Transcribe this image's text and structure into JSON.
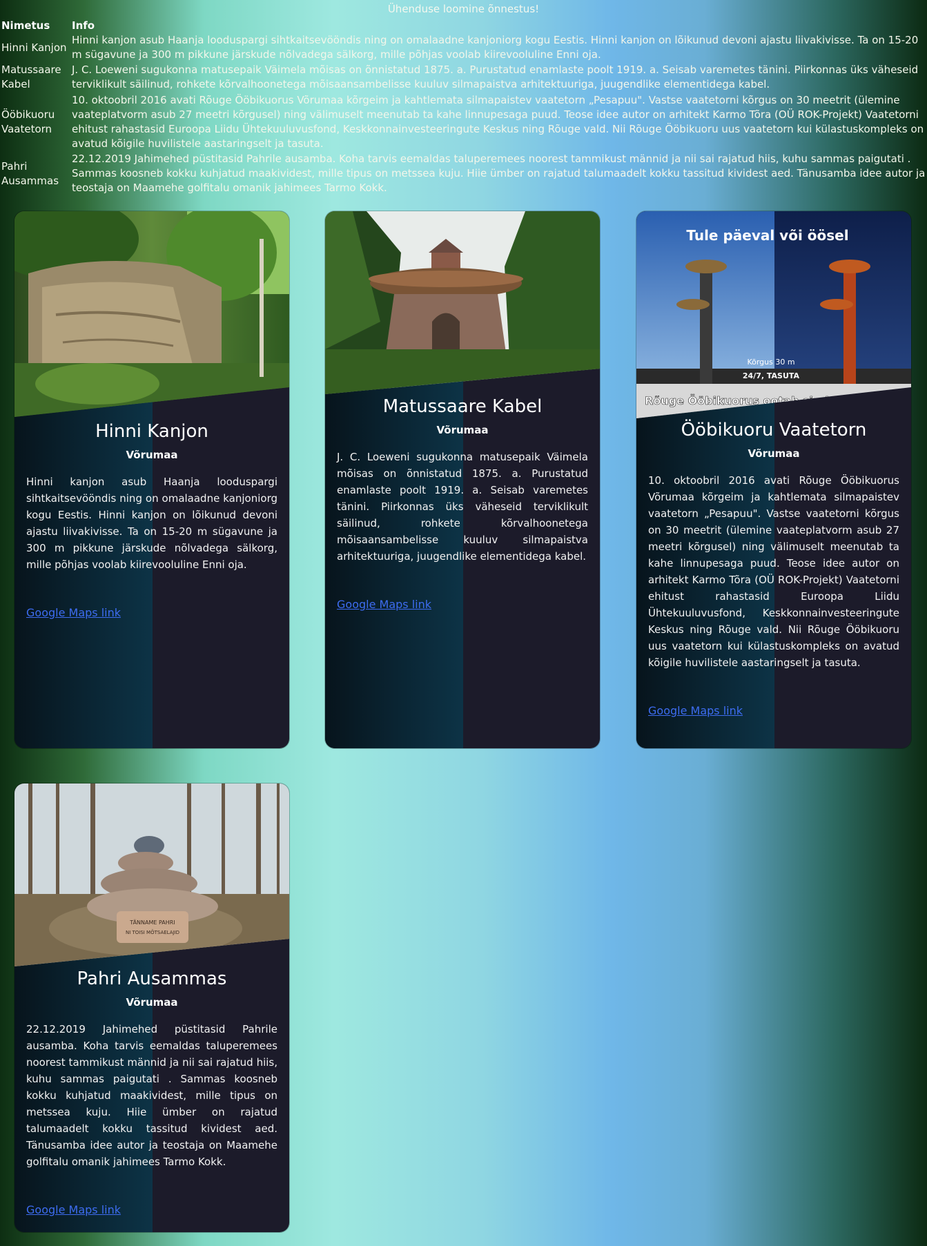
{
  "status_message": "Ühenduse loomine õnnestus!",
  "table": {
    "headers": [
      "Nimetus",
      "Info"
    ],
    "rows": [
      {
        "name_line1": "Hinni Kanjon",
        "name_line2": "",
        "info": "Hinni kanjon asub Haanja looduspargi sihtkaitsevööndis ning on omalaadne kanjoniorg kogu Eestis. Hinni kanjon on lõikunud devoni ajastu liivakivisse. Ta on 15-20 m sügavune ja 300 m pikkune järskude nõlvadega sälkorg, mille põhjas voolab kiirevooluline Enni oja."
      },
      {
        "name_line1": "Matussaare",
        "name_line2": "Kabel",
        "info": "J. C. Loeweni sugukonna matusepaik Väimela mõisas on õnnistatud 1875. a. Purustatud enamlaste poolt 1919. a. Seisab varemetes tänini. Piirkonnas üks väheseid terviklikult säilinud, rohkete kõrvalhoonetega mõisaansambelisse kuuluv silmapaistva arhitektuuriga, juugendlike elementidega kabel."
      },
      {
        "name_line1": "Ööbikuoru",
        "name_line2": "Vaatetorn",
        "info": "10. oktoobril 2016 avati Rõuge Ööbikuorus Võrumaa kõrgeim ja kahtlemata silmapaistev vaatetorn „Pesapuu\". Vastse vaatetorni kõrgus on 30 meetrit (ülemine vaateplatvorm asub 27 meetri kõrgusel) ning välimuselt meenutab ta kahe linnupesaga puud. Teose idee autor on arhitekt Karmo Tõra (OÜ ROK-Projekt) Vaatetorni ehitust rahastasid Euroopa Liidu Ühtekuuluvusfond, Keskkonnainvesteeringute Keskus ning Rõuge vald. Nii Rõuge Ööbikuoru uus vaatetorn kui külastuskompleks on avatud kõigile huvilistele aastaringselt ja tasuta."
      },
      {
        "name_line1": "Pahri",
        "name_line2": "Ausammas",
        "info": "22.12.2019 Jahimehed püstitasid Pahrile ausamba. Koha tarvis eemaldas taluperemees noorest tammikust männid ja nii sai rajatud hiis, kuhu sammas paigutati . Sammas koosneb kokku kuhjatud maakividest, mille tipus on metssea kuju. Hiie ümber on rajatud talumaadelt kokku tassitud kividest aed. Tänusamba idee autor ja teostaja on Maamehe golfitalu omanik jahimees Tarmo Kokk."
      }
    ]
  },
  "cards": [
    {
      "title": "Hinni Kanjon",
      "region": "Võrumaa",
      "description": "Hinni kanjon asub Haanja looduspargi sihtkaitsevööndis ning on omalaadne kanjoniorg kogu Eestis. Hinni kanjon on lõikunud devoni ajastu liivakivisse. Ta on 15-20 m sügavune ja 300 m pikkune järskude nõlvadega sälkorg, mille põhjas voolab kiirevooluline Enni oja.",
      "link_label": "Google Maps link"
    },
    {
      "title": "Matussaare Kabel",
      "region": "Võrumaa",
      "description": "J. C. Loeweni sugukonna matusepaik Väimela mõisas on õnnistatud 1875. a. Purustatud enamlaste poolt 1919. a. Seisab varemetes tänini. Piirkonnas üks väheseid terviklikult säilinud, rohkete kõrvalhoonetega mõisaansambelisse kuuluv silmapaistva arhitektuuriga, juugendlike elementidega kabel.",
      "link_label": "Google Maps link"
    },
    {
      "title": "Ööbikuoru Vaatetorn",
      "region": "Võrumaa",
      "description": "10. oktoobril 2016 avati Rõuge Ööbikuorus Võrumaa kõrgeim ja kahtlemata silmapaistev vaatetorn „Pesapuu\". Vastse vaatetorni kõrgus on 30 meetrit (ülemine vaateplatvorm asub 27 meetri kõrgusel) ning välimuselt meenutab ta kahe linnupesaga puud. Teose idee autor on arhitekt Karmo Tõra (OÜ ROK-Projekt) Vaatetorni ehitust rahastasid Euroopa Liidu Ühtekuuluvusfond, Keskkonnainvesteeringute Keskus ning Rõuge vald. Nii Rõuge Ööbikuoru uus vaatetorn kui külastuskompleks on avatud kõigile huvilistele aastaringselt ja tasuta.",
      "link_label": "Google Maps link",
      "photo_text": {
        "headline": "Tule päeval või öösel",
        "height": "Kõrgus 30 m",
        "hours": "24/7, TASUTA",
        "banner": "Rõuge Ööbikuorus ootab sind Pesapuu"
      }
    },
    {
      "title": "Pahri Ausammas",
      "region": "Võrumaa",
      "description": "22.12.2019 Jahimehed püstitasid Pahrile ausamba. Koha tarvis eemaldas taluperemees noorest tammikust männid ja nii sai rajatud hiis, kuhu sammas paigutati . Sammas koosneb kokku kuhjatud maakividest, mille tipus on metssea kuju. Hiie ümber on rajatud talumaadelt kokku tassitud kividest aed. Tänusamba idee autor ja teostaja on Maamehe golfitalu omanik jahimees Tarmo Kokk.",
      "link_label": "Google Maps link",
      "photo_text": {
        "plaque_line1": "TÄNNAME PAHRI",
        "plaque_line2": "NI TOISI MÕTSAELAJID"
      }
    }
  ]
}
